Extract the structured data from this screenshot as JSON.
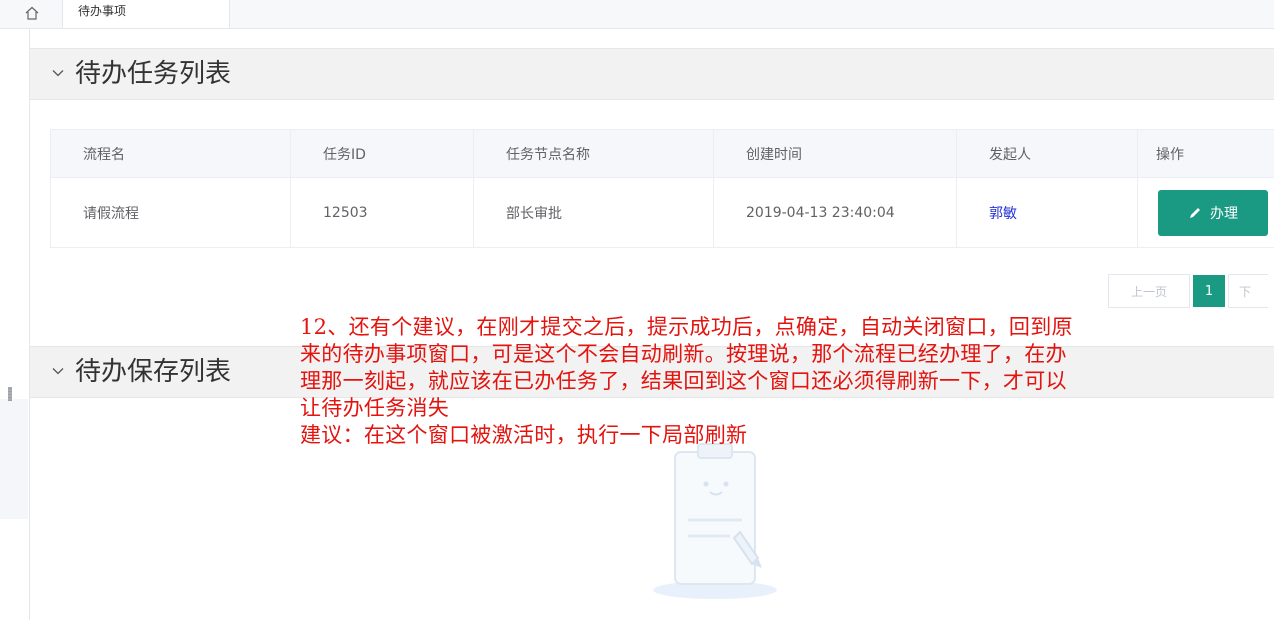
{
  "tabbar": {
    "home_icon": "home-icon",
    "active_tab_label": "待办事项"
  },
  "todo_section": {
    "title": "待办任务列表",
    "table": {
      "headers": [
        "流程名",
        "任务ID",
        "任务节点名称",
        "创建时间",
        "发起人",
        "操作"
      ],
      "rows": [
        {
          "process_name": "请假流程",
          "task_id": "12503",
          "node_name": "部长审批",
          "created_at": "2019-04-13 23:40:04",
          "initiator": "郭敏",
          "action_label": "办理",
          "action_icon": "pencil-icon"
        }
      ]
    },
    "pagination": {
      "prev_label": "上一页",
      "current_page": "1",
      "next_label": "下"
    }
  },
  "saved_section": {
    "title": "待办保存列表"
  },
  "annotation": {
    "lines": [
      "12、还有个建议，在刚才提交之后，提示成功后，点确定，自动关闭窗口，回到原",
      "来的待办事项窗口，可是这个不会自动刷新。按理说，那个流程已经办理了，在办",
      "理那一刻起，就应该在已办任务了，结果回到这个窗口还必须得刷新一下，才可以",
      "让待办任务消失",
      "建议：在这个窗口被激活时，执行一下局部刷新"
    ],
    "color": "#e3130e"
  },
  "colors": {
    "accent": "#1a9a83",
    "initiator_link": "#2230d9"
  }
}
